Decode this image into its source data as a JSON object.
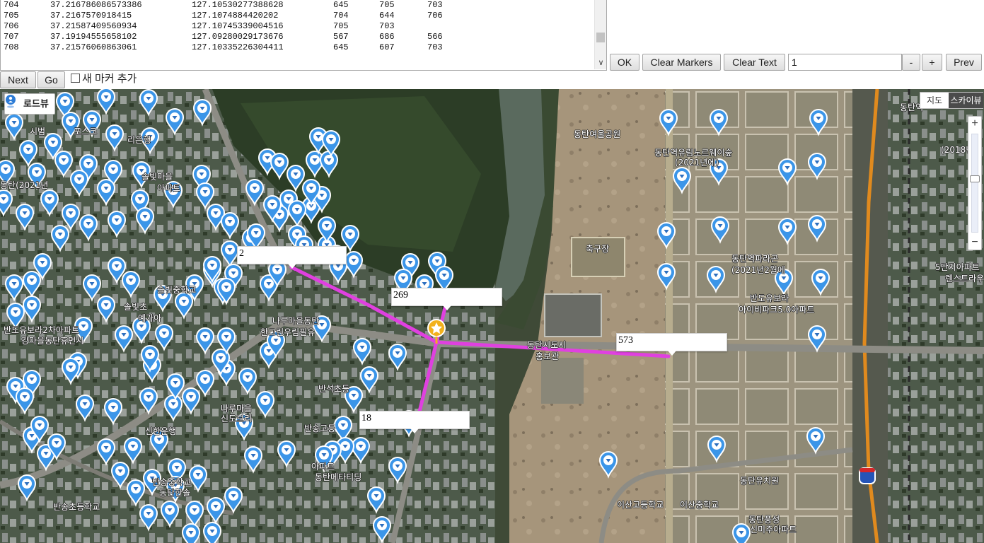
{
  "data_rows": [
    [
      "704",
      "37.216786086573386",
      "127.10530277388628",
      "645",
      "705",
      "703"
    ],
    [
      "705",
      "37.2167570918415",
      "127.1074884420202",
      "704",
      "644",
      "706"
    ],
    [
      "706",
      "37.21587409560934",
      "127.10745339004516",
      "705",
      "703",
      ""
    ],
    [
      "707",
      "37.19194555658102",
      "127.09280029173676",
      "567",
      "686",
      "566"
    ],
    [
      "708",
      "37.21576060863061",
      "127.10335226304411",
      "645",
      "607",
      "703"
    ]
  ],
  "toolbar": {
    "ok": "OK",
    "clear_markers": "Clear Markers",
    "clear_text": "Clear Text",
    "page_value": "1",
    "minus": "-",
    "plus": "+",
    "prev": "Prev",
    "next": "Next",
    "go": "Go",
    "add_marker_label": "새 마커 추가"
  },
  "map": {
    "roadview_label": "로드뷰",
    "maptype_map": "지도",
    "maptype_skyview": "스카이뷰",
    "zoom_level_fraction": 0.45,
    "route_color": "#e040e0",
    "pin_color": "#3b95e8",
    "infoboxes": [
      "2",
      "269",
      "573",
      "18"
    ],
    "labels": [
      "동탄역",
      "동탄여울공원",
      "동탄역유림노르웨이숲",
      "(2021년에)",
      "동탄역파라곤",
      "(2021년2월에",
      "반도유보라",
      "아이비파크5.0아파트",
      "동탄시도시",
      "홍보관",
      "축구장",
      "동탄유치원",
      "이산고등학교",
      "이산중학교",
      "동탄풍성",
      "신미주아파트",
      "시범",
      "포스크",
      "리은행",
      "솔빛마을",
      "아파트",
      "솔빛중학교",
      "솔빛초",
      "예가아",
      "나루마을동탄",
      "한그린우림필유",
      "반석초등",
      "나루마을",
      "신도브리",
      "반송고등",
      "신한은행",
      "반송초등학교",
      "반송중학교",
      "동탄한솔",
      "아파트",
      "동탄메타티딩",
      "반도유보라2차아파트",
      "강마을동탄휴먼시",
      "5단지아파트",
      "렌스트라우스",
      "(2018년9",
      "동탄(2021년",
      "시세"
    ]
  }
}
